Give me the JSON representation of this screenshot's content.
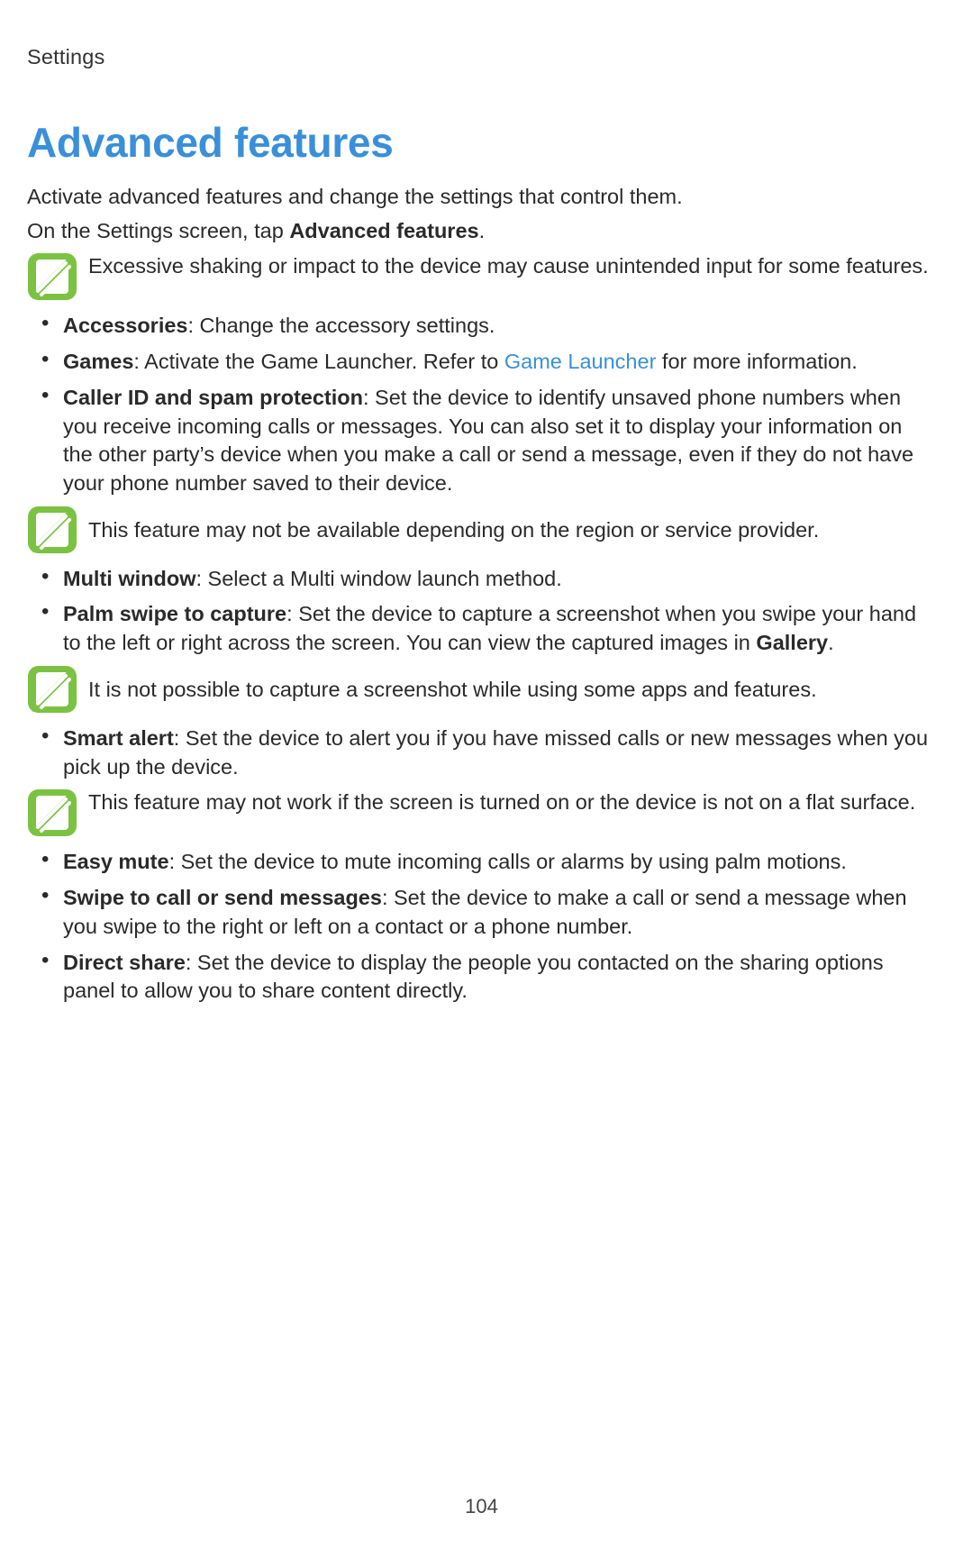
{
  "header": "Settings",
  "title": "Advanced features",
  "intro1": "Activate advanced features and change the settings that control them.",
  "intro2_a": "On the Settings screen, tap ",
  "intro2_b": "Advanced features",
  "intro2_c": ".",
  "note1": "Excessive shaking or impact to the device may cause unintended input for some features.",
  "bullets1": {
    "accessories_label": "Accessories",
    "accessories_text": ": Change the accessory settings.",
    "games_label": "Games",
    "games_text_a": ": Activate the Game Launcher. Refer to ",
    "games_link": "Game Launcher",
    "games_text_b": " for more information.",
    "callerid_label": "Caller ID and spam protection",
    "callerid_text": ": Set the device to identify unsaved phone numbers when you receive incoming calls or messages. You can also set it to display your information on the other party’s device when you make a call or send a message, even if they do not have your phone number saved to their device."
  },
  "note2": "This feature may not be available depending on the region or service provider.",
  "bullets2": {
    "multiwindow_label": "Multi window",
    "multiwindow_text": ": Select a Multi window launch method.",
    "palm_label": "Palm swipe to capture",
    "palm_text_a": ": Set the device to capture a screenshot when you swipe your hand to the left or right across the screen. You can view the captured images in ",
    "palm_text_bold": "Gallery",
    "palm_text_b": "."
  },
  "note3": "It is not possible to capture a screenshot while using some apps and features.",
  "bullets3": {
    "smart_label": "Smart alert",
    "smart_text": ": Set the device to alert you if you have missed calls or new messages when you pick up the device."
  },
  "note4": "This feature may not work if the screen is turned on or the device is not on a flat surface.",
  "bullets4": {
    "easymute_label": "Easy mute",
    "easymute_text": ": Set the device to mute incoming calls or alarms by using palm motions.",
    "swipe_label": "Swipe to call or send messages",
    "swipe_text": ": Set the device to make a call or send a message when you swipe to the right or left on a contact or a phone number.",
    "direct_label": "Direct share",
    "direct_text": ": Set the device to display the people you contacted on the sharing options panel to allow you to share content directly."
  },
  "page_number": "104"
}
